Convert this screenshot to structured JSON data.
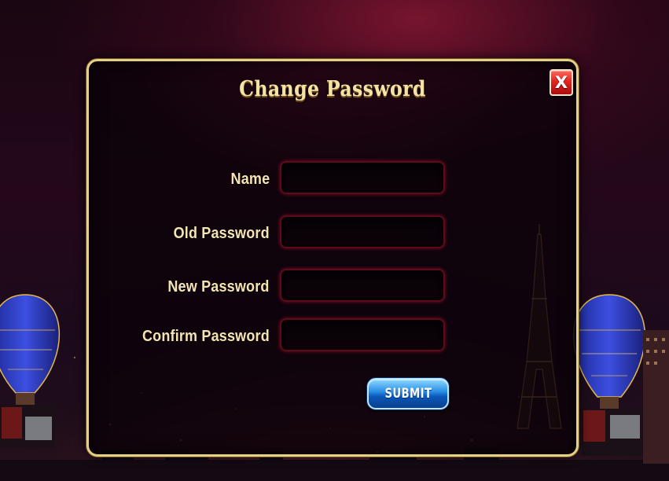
{
  "dialog": {
    "title": "Change Password",
    "close_label": "X"
  },
  "form": {
    "fields": [
      {
        "label": "Name",
        "value": "",
        "placeholder": ""
      },
      {
        "label": "Old Password",
        "value": "",
        "placeholder": ""
      },
      {
        "label": "New Password",
        "value": "",
        "placeholder": ""
      },
      {
        "label": "Confirm Password",
        "value": "",
        "placeholder": ""
      }
    ],
    "submit_label": "SUBMIT"
  },
  "background": {
    "scene": "las-vegas-night-skyline",
    "icons": [
      "hot-air-balloon-icon",
      "eiffel-tower-icon"
    ]
  },
  "colors": {
    "panel_border": "#e6cf86",
    "title_text": "#f5e3a6",
    "label_text": "#f6e3b2",
    "input_glow": "#a01430",
    "close_button": "#e0261f",
    "submit_button": "#2b8fe6"
  }
}
